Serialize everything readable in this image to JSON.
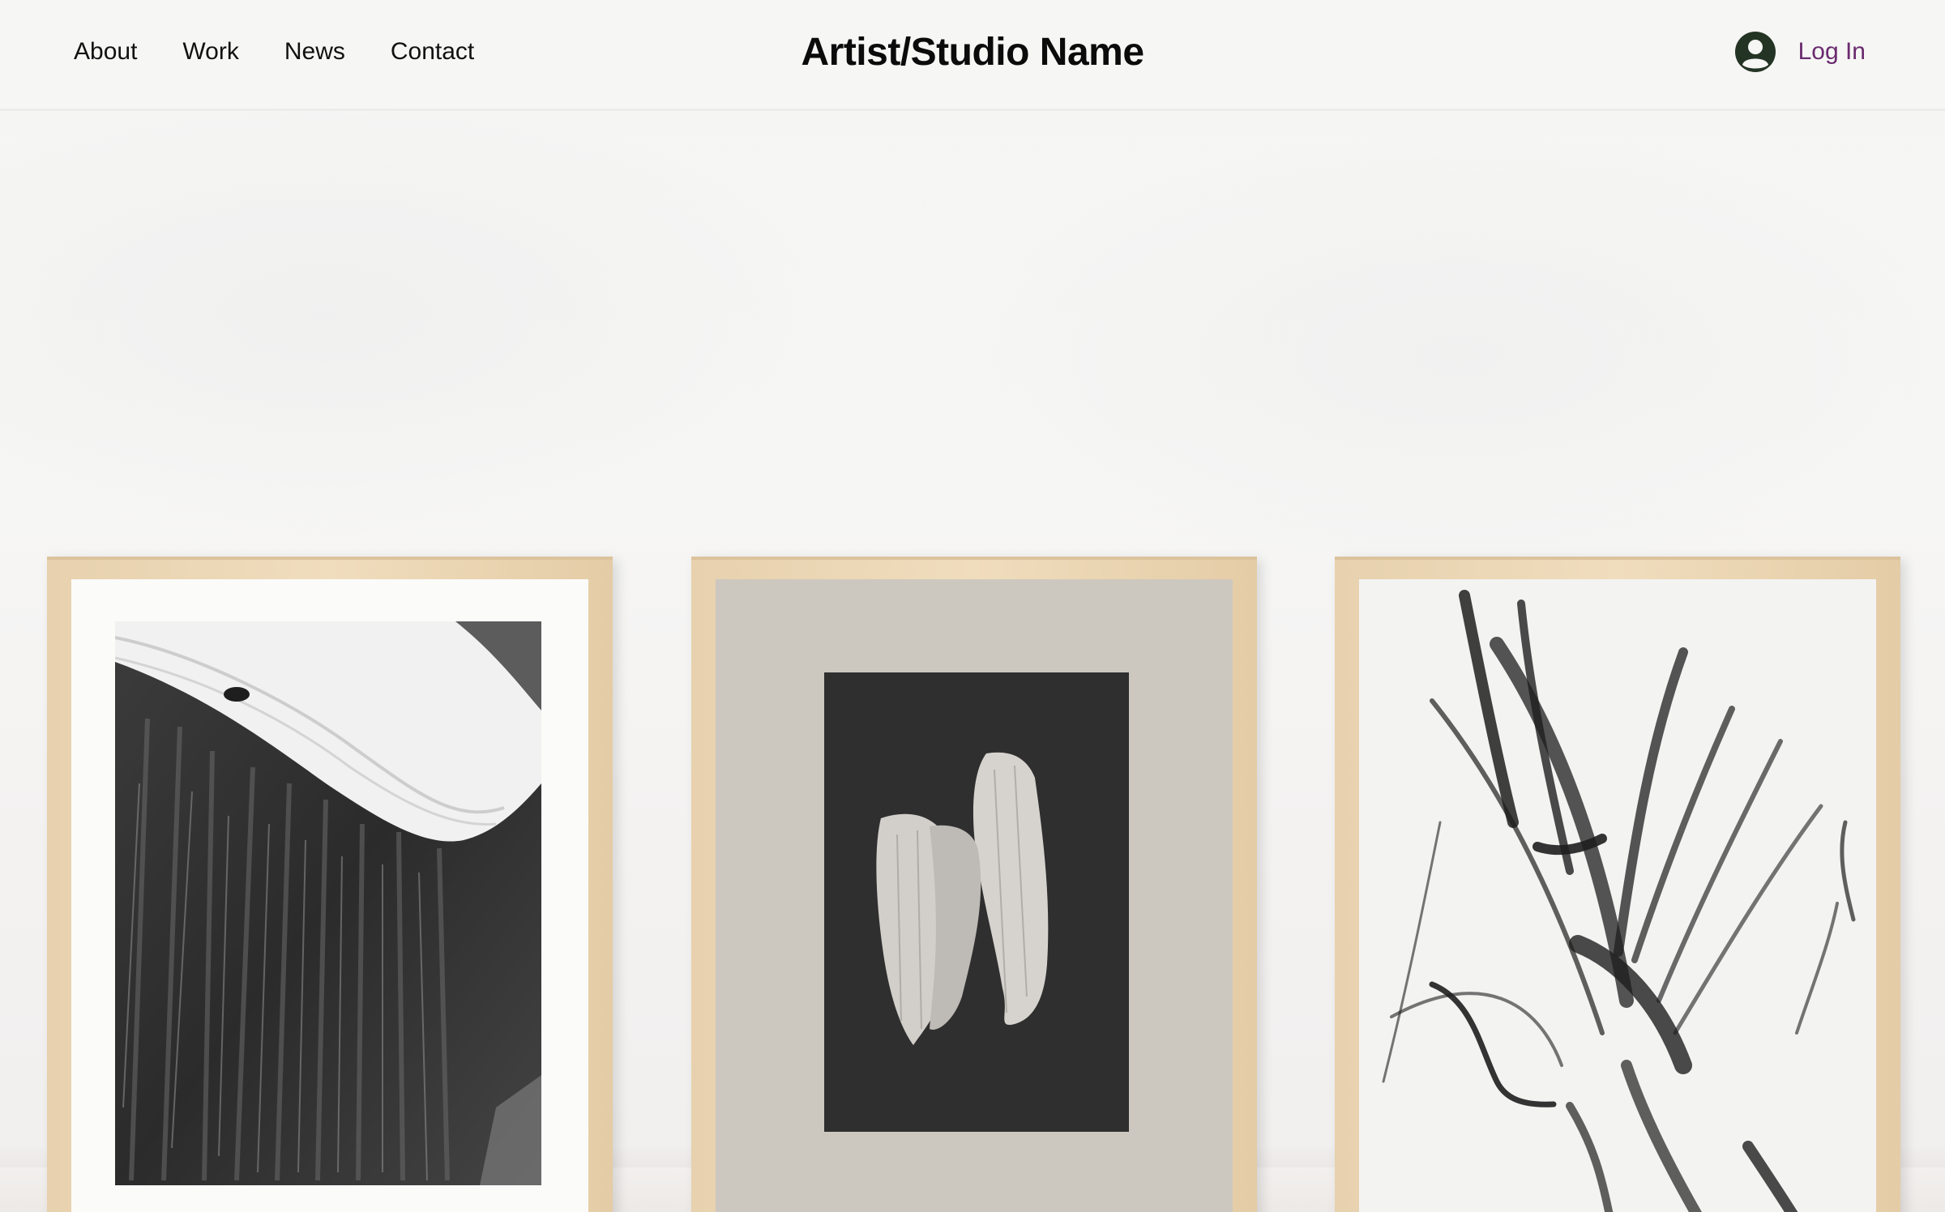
{
  "header": {
    "nav": [
      {
        "label": "About"
      },
      {
        "label": "Work"
      },
      {
        "label": "News"
      },
      {
        "label": "Contact"
      }
    ],
    "site_title": "Artist/Studio Name",
    "login_label": "Log In",
    "login_color": "#6a2a6e",
    "avatar_icon": "user-avatar-icon"
  },
  "artworks": [
    {
      "name": "black-and-white-brush-painting",
      "mat_color": "#fbfbfa"
    },
    {
      "name": "white-brushstrokes-on-black",
      "mat_color": "#cdc8bf"
    },
    {
      "name": "black-ink-gestures-on-white",
      "mat_color": "#f3f3f2"
    }
  ]
}
